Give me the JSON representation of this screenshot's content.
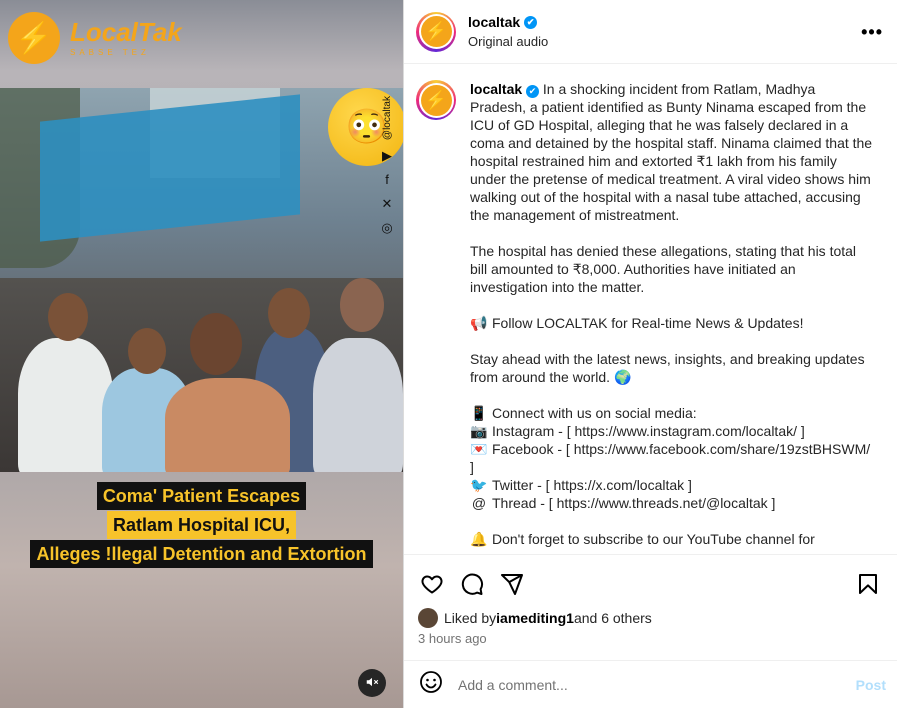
{
  "media": {
    "brand_name": "LocalTak",
    "brand_tagline": "SABSE TEZ",
    "brand_letter": "⚡",
    "vertical_handle": "@localtak",
    "headline_lines": [
      "Coma' Patient Escapes",
      "Ratlam Hospital ICU,",
      "Alleges !llegal Detention and Extortion"
    ],
    "mute_icon": "🔇"
  },
  "header": {
    "username": "localtak",
    "verified": "✔",
    "subtitle": "Original audio",
    "more": "•••",
    "avatar_letter": "⚡"
  },
  "caption": {
    "username": "localtak",
    "verified": "✔",
    "p1": "In a shocking incident from Ratlam, Madhya Pradesh, a patient identified as Bunty Ninama escaped from the ICU of GD Hospital, alleging that he was falsely declared in a coma and detained by the hospital staff. Ninama claimed that the hospital restrained him and extorted ₹1 lakh from his family under the pretense of medical treatment. A viral video shows him walking out of the hospital with a nasal tube attached, accusing the management of mistreatment.",
    "p2": "The hospital has denied these allegations, stating that his total bill amounted to ₹8,000. Authorities have initiated an investigation into the matter.",
    "p3_icon": "📢",
    "p3": "Follow LOCALTAK for Real-time News & Updates!",
    "p4": "Stay ahead with the latest news, insights, and breaking updates from around the world. 🌍",
    "p5_icon": "📱",
    "p5": "Connect with us on social media:",
    "ig_icon": "📷",
    "ig": "Instagram - [ https://www.instagram.com/localtak/ ]",
    "fb_icon": "💌",
    "fb": "Facebook - [ https://www.facebook.com/share/19zstBHSWM/ ]",
    "tw_icon": "🐦",
    "tw": "Twitter - [ https://x.com/localtak ]",
    "th_icon": "@",
    "th": "Thread - [ https://www.threads.net/@localtak ]",
    "yt_icon": "🔔",
    "yt": "Don't forget to subscribe to our YouTube channel for"
  },
  "actions": {
    "like": "heart-icon",
    "comment": "comment-icon",
    "share": "share-icon",
    "save": "bookmark-icon"
  },
  "likes": {
    "prefix": "Liked by ",
    "user": "iamediting1",
    "suffix": " and 6 others"
  },
  "time": "3 hours ago",
  "comment": {
    "placeholder": "Add a comment...",
    "post_label": "Post"
  },
  "colors": {
    "brand_orange": "#f4a51a",
    "verified_blue": "#0095f6",
    "post_disabled": "#b2dffc"
  }
}
